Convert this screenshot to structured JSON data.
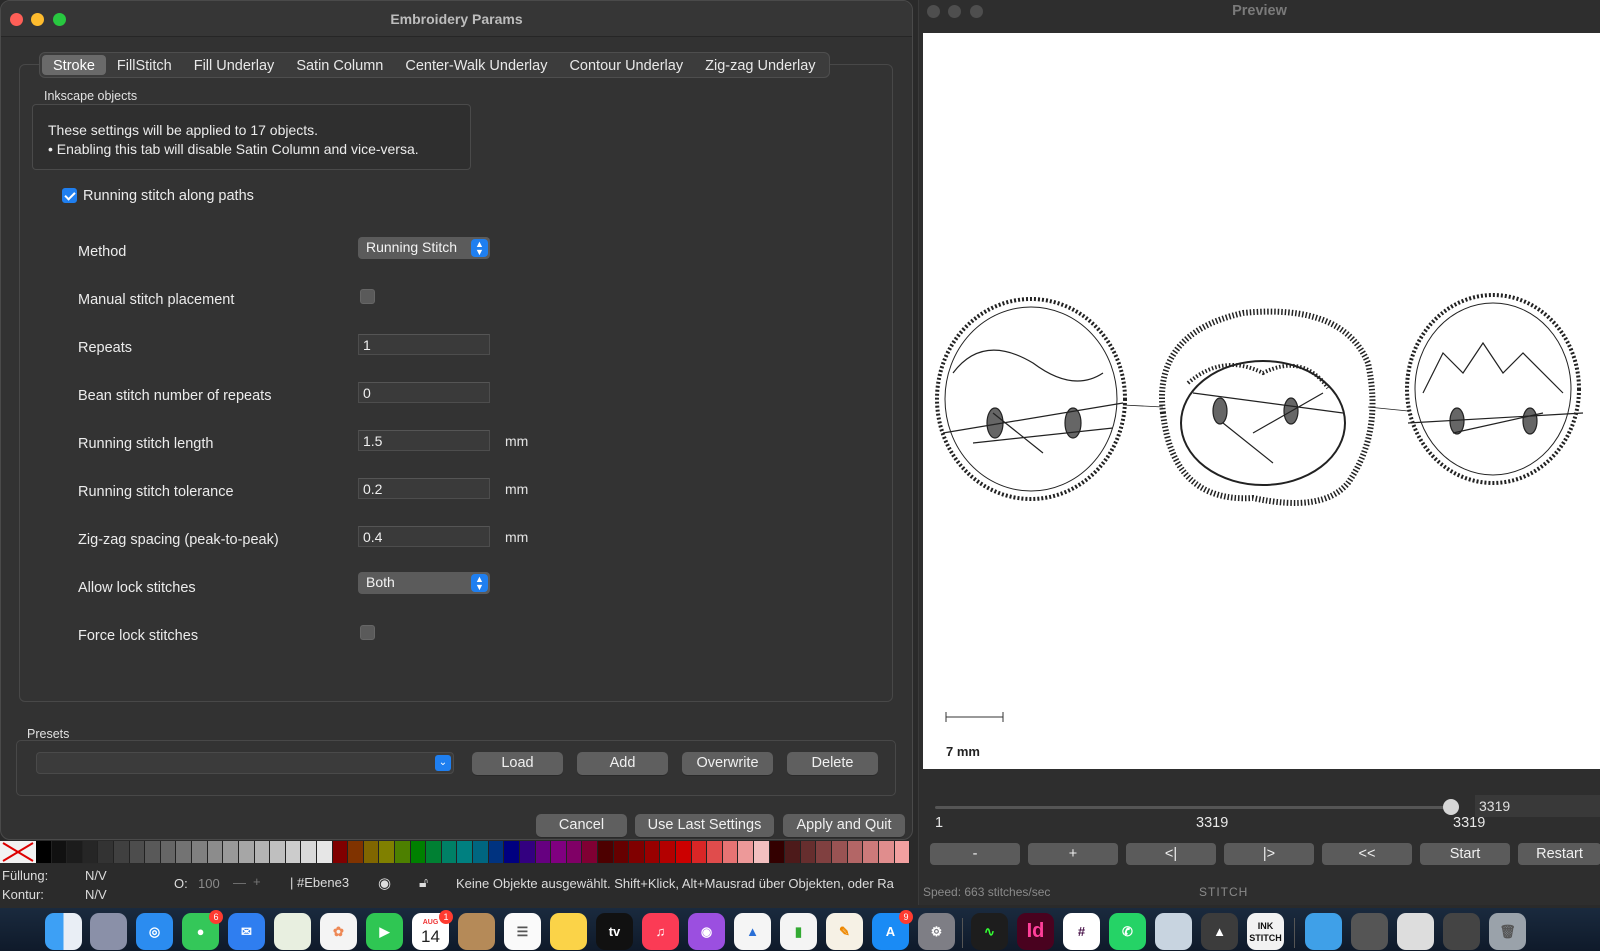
{
  "params_window": {
    "title": "Embroidery Params",
    "tabs": [
      "Stroke",
      "FillStitch",
      "Fill Underlay",
      "Satin Column",
      "Center-Walk Underlay",
      "Contour Underlay",
      "Zig-zag Underlay"
    ],
    "active_tab": "Stroke",
    "group_label": "Inkscape objects",
    "info_line1": "These settings will be applied to 17 objects.",
    "info_line2": "• Enabling this tab will disable Satin Column and vice-versa.",
    "enable_checkbox": {
      "label": "Running stitch along paths",
      "checked": true
    },
    "fields": {
      "method": {
        "label": "Method",
        "value": "Running Stitch"
      },
      "manual": {
        "label": "Manual stitch placement",
        "checked": false
      },
      "repeats": {
        "label": "Repeats",
        "value": "1"
      },
      "bean": {
        "label": "Bean stitch number of repeats",
        "value": "0"
      },
      "run_len": {
        "label": "Running stitch length",
        "value": "1.5",
        "unit": "mm"
      },
      "run_tol": {
        "label": "Running stitch tolerance",
        "value": "0.2",
        "unit": "mm"
      },
      "zigzag": {
        "label": "Zig-zag spacing (peak-to-peak)",
        "value": "0.4",
        "unit": "mm"
      },
      "allow_lock": {
        "label": "Allow lock stitches",
        "value": "Both"
      },
      "force_lock": {
        "label": "Force lock stitches",
        "checked": false
      }
    },
    "presets": {
      "label": "Presets",
      "selected": "",
      "load": "Load",
      "add": "Add",
      "overwrite": "Overwrite",
      "delete": "Delete"
    },
    "footer": {
      "cancel": "Cancel",
      "use_last": "Use Last Settings",
      "apply_quit": "Apply and Quit"
    }
  },
  "inkscape_status": {
    "fill_label": "Füllung:",
    "fill_value": "N/V",
    "stroke_label": "Kontur:",
    "stroke_value": "N/V",
    "opacity_label": "O:",
    "opacity_value": "100",
    "layer": "#Ebene3",
    "message": "Keine Objekte ausgewählt. Shift+Klick, Alt+Mausrad über Objekten, oder Ra"
  },
  "palette_colors": [
    "#000000",
    "#111111",
    "#1c1c1c",
    "#262626",
    "#333333",
    "#404040",
    "#4d4d4d",
    "#595959",
    "#666666",
    "#737373",
    "#808080",
    "#8c8c8c",
    "#999999",
    "#a6a6a6",
    "#b3b3b3",
    "#bfbfbf",
    "#cccccc",
    "#d9d9d9",
    "#e6e6e6",
    "#800000",
    "#803300",
    "#806600",
    "#808000",
    "#4d8000",
    "#008000",
    "#008033",
    "#008066",
    "#008080",
    "#006680",
    "#003380",
    "#000080",
    "#330080",
    "#660080",
    "#800080",
    "#800066",
    "#800033",
    "#4d0000",
    "#660000",
    "#800000",
    "#990000",
    "#b30000",
    "#cc0000",
    "#d92626",
    "#e04c4c",
    "#e67373",
    "#ed9999",
    "#f2bfbf",
    "#330000",
    "#4d1a1a",
    "#662e2e",
    "#804040",
    "#995353",
    "#b36666",
    "#cc7a7a",
    "#e08d8d",
    "#f2a0a0"
  ],
  "preview_window": {
    "title": "Preview",
    "scale_label": "7 mm",
    "slider_value": "3319",
    "stitch_min": "1",
    "stitch_current": "3319",
    "stitch_max": "3319",
    "buttons": [
      "-",
      "+",
      "<|",
      "|>",
      "<<",
      "Start",
      "Restart"
    ],
    "speed": "Speed: 663 stitches/sec",
    "mode": "STITCH"
  },
  "dock": {
    "calendar_month": "AUG",
    "calendar_day": "14",
    "tv_label": "tv",
    "indesign_label": "Id",
    "inkstitch_label": "INK STITCH",
    "badges": {
      "messages": "6",
      "calendar": "1",
      "appstore": "9"
    }
  }
}
